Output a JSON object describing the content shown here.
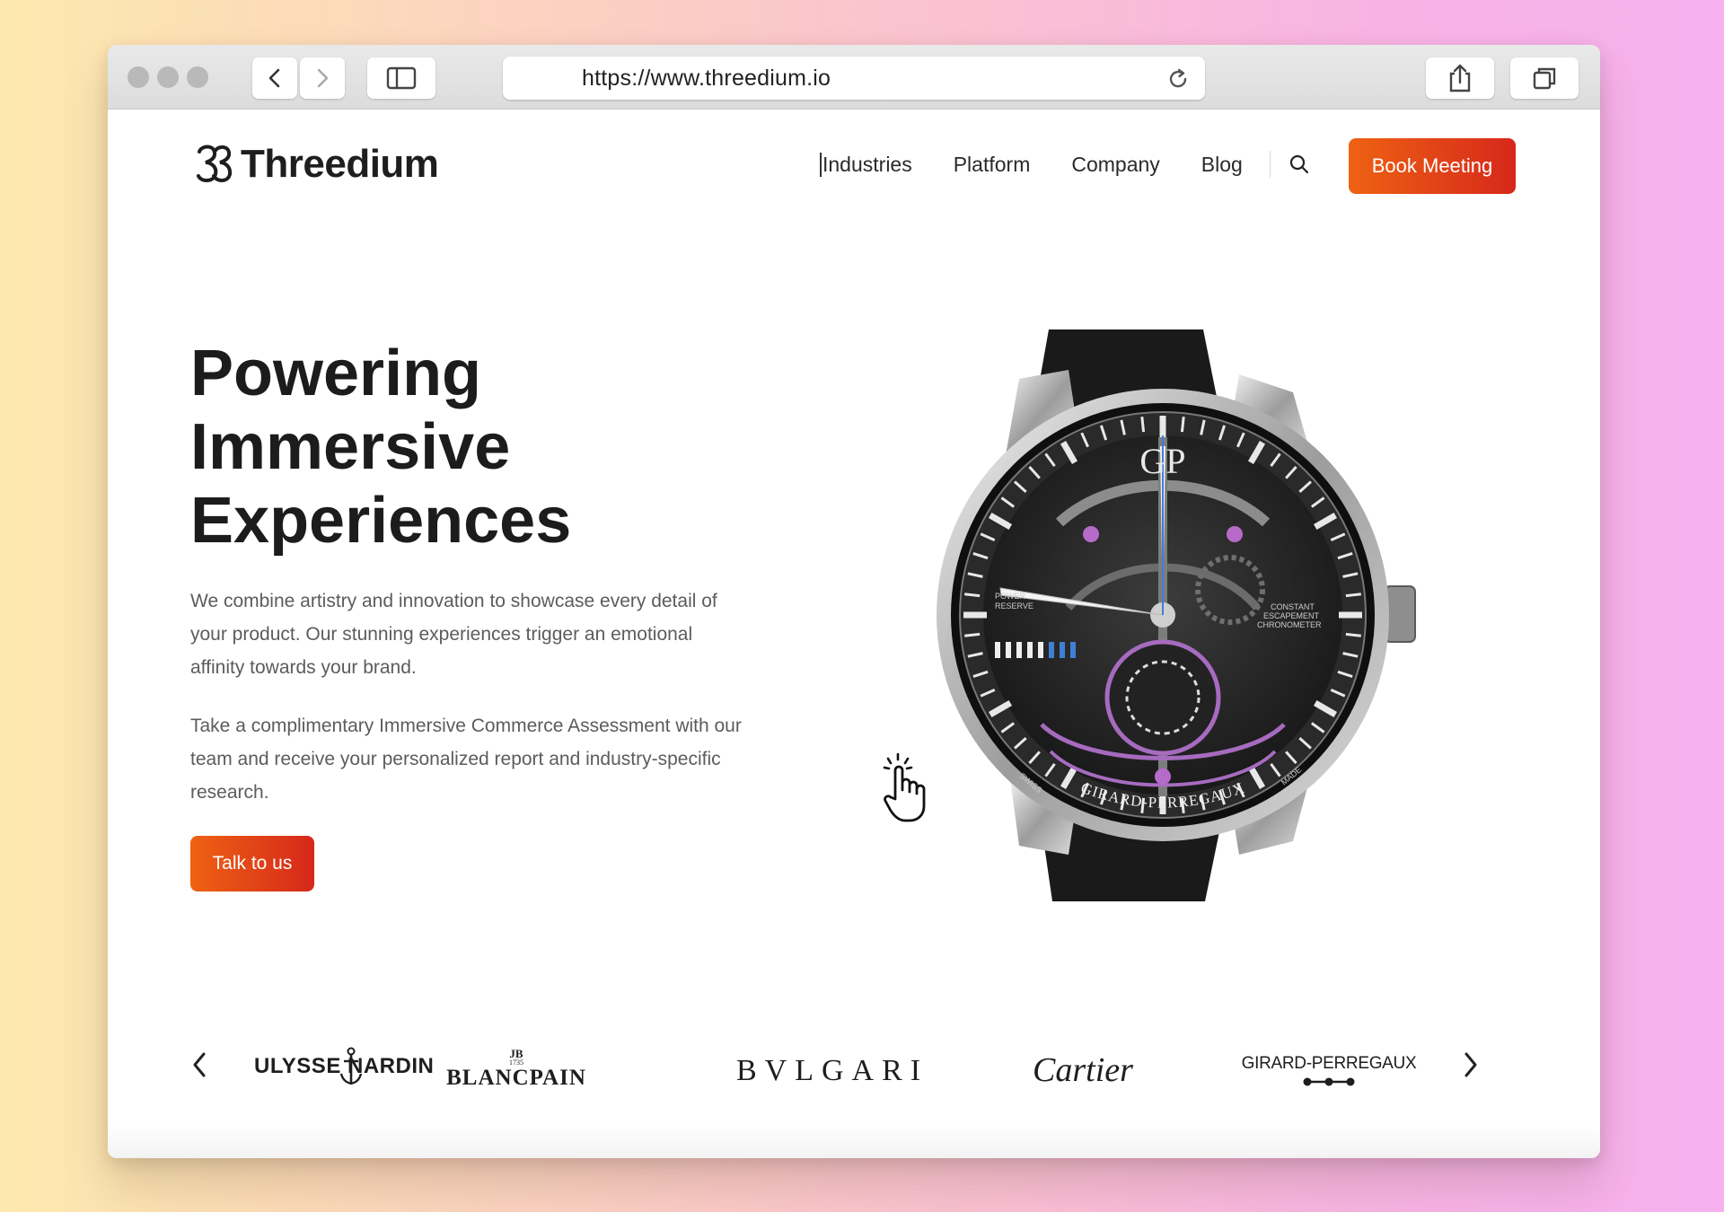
{
  "browser": {
    "url": "https://www.threedium.io",
    "icons": [
      "back-icon",
      "forward-icon",
      "sidebar-icon",
      "reload-icon",
      "share-icon",
      "tabs-icon"
    ]
  },
  "site": {
    "logo_text": "Threedium",
    "nav": {
      "items": [
        "Industries",
        "Platform",
        "Company",
        "Blog"
      ],
      "book_label": "Book Meeting"
    },
    "hero": {
      "title_lines": [
        "Powering",
        "Immersive",
        "Experiences"
      ],
      "para1_lines": [
        "We combine artistry and innovation to showcase every detail of",
        "your product. Our stunning experiences trigger an emotional",
        "affinity towards your brand."
      ],
      "para2_lines": [
        "Take a complimentary Immersive Commerce Assessment with our",
        "team and receive your personalized report and industry-specific",
        "research."
      ],
      "cta_label": "Talk to us"
    },
    "watch": {
      "logo": "GP",
      "brand": "GIRARD-PERREGAUX",
      "text_left_1": "POWER",
      "text_left_2": "RESERVE",
      "text_right_1": "CONSTANT",
      "text_right_2": "ESCAPEMENT",
      "text_right_3": "CHRONOMETER",
      "text_swiss": "SWISS",
      "text_made": "MADE"
    },
    "brands": {
      "items": [
        "ULYSSE NARDIN",
        "BLANCPAIN",
        "BVLGARI",
        "Cartier",
        "GIRARD-PERREGAUX"
      ],
      "blancpain_mark": "JB",
      "blancpain_year": "1735"
    }
  },
  "colors": {
    "accent_start": "#ee6213",
    "accent_end": "#d6281b",
    "text_dark": "#1c1c1c",
    "text_body": "#5c5c5c"
  }
}
